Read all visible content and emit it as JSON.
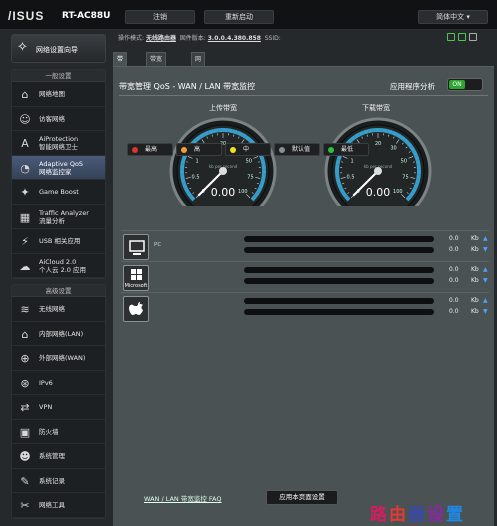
{
  "header": {
    "brand": "/ISUS",
    "model": "RT-AC88U",
    "logout": "注销",
    "reboot": "重新启动",
    "language": "简体中文",
    "opmode_label": "操作模式:",
    "opmode_value": "无线路由器",
    "firmware_label": "固件版本:",
    "firmware_value": "3.0.0.4.380.858",
    "ssid_label": "SSID:"
  },
  "sidebar": {
    "quick_setup": "网络设置向导",
    "general_header": "一般设置",
    "general_items": [
      {
        "icon": "network-map-icon",
        "label": "网络地图",
        "glyph": "⌂"
      },
      {
        "icon": "guest-network-icon",
        "label": "访客网络",
        "glyph": "☺"
      },
      {
        "icon": "aiprotection-icon",
        "label": "AiProtection",
        "sub": "智能网络卫士",
        "glyph": "A"
      },
      {
        "icon": "adaptive-qos-icon",
        "label": "Adaptive QoS",
        "sub": "网络监控家",
        "glyph": "◔"
      },
      {
        "icon": "game-boost-icon",
        "label": "Game Boost",
        "glyph": "✦"
      },
      {
        "icon": "traffic-analyzer-icon",
        "label": "Traffic Analyzer",
        "sub": "流量分析",
        "glyph": "▦"
      },
      {
        "icon": "usb-app-icon",
        "label": "USB 相关应用",
        "glyph": "⚡"
      },
      {
        "icon": "aicloud-icon",
        "label": "AiCloud 2.0",
        "sub": "个人云 2.0 应用",
        "glyph": "☁"
      }
    ],
    "advanced_header": "高级设置",
    "advanced_items": [
      {
        "icon": "wireless-icon",
        "label": "无线网络",
        "glyph": "≋"
      },
      {
        "icon": "lan-icon",
        "label": "内部网络(LAN)",
        "glyph": "⌂"
      },
      {
        "icon": "wan-icon",
        "label": "外部网络(WAN)",
        "glyph": "⊕"
      },
      {
        "icon": "ipv6-icon",
        "label": "IPv6",
        "glyph": "⊛"
      },
      {
        "icon": "vpn-icon",
        "label": "VPN",
        "glyph": "⇄"
      },
      {
        "icon": "firewall-icon",
        "label": "防火墙",
        "glyph": "▣"
      },
      {
        "icon": "administration-icon",
        "label": "系统管理",
        "glyph": "☻"
      },
      {
        "icon": "system-log-icon",
        "label": "系统记录",
        "glyph": "✎"
      },
      {
        "icon": "network-tools-icon",
        "label": "网络工具",
        "glyph": "✂"
      }
    ]
  },
  "tabs": [
    "带宽监控",
    "带宽管理 QoS",
    "网页浏览历史"
  ],
  "main": {
    "title": "带宽管理 QoS - WAN / LAN 带宽监控",
    "app_analysis_label": "应用程序分析",
    "toggle_state": "ON",
    "upload_label": "上传带宽",
    "download_label": "下载带宽",
    "gauge_unit": "kb per second",
    "gauge_ticks": [
      "0",
      "0.5",
      "1",
      "10",
      "20",
      "30",
      "50",
      "75",
      "100"
    ],
    "upload_value": "0.00",
    "download_value": "0.00",
    "faq_link": "WAN / LAN 带宽监控 FAQ",
    "apply_button": "应用本页面设置"
  },
  "legend": [
    {
      "label": "最高",
      "color": "#e03030"
    },
    {
      "label": "高",
      "color": "#f0a030"
    },
    {
      "label": "中",
      "color": "#f0e020"
    },
    {
      "label": "默认值",
      "color": "#8a8f90"
    },
    {
      "label": "最低",
      "color": "#30c040"
    }
  ],
  "clients": [
    {
      "icon": "pc-icon",
      "icon_text": "",
      "name": "PC",
      "up": "0.0",
      "down": "0.0",
      "unit": "Kb"
    },
    {
      "icon": "microsoft-icon",
      "icon_text": "Microsoft",
      "name": "",
      "up": "0.0",
      "down": "0.0",
      "unit": "Kb"
    },
    {
      "icon": "apple-icon",
      "icon_text": "",
      "name": "",
      "up": "0.0",
      "down": "0.0",
      "unit": "Kb"
    }
  ],
  "watermark": [
    "路",
    "由",
    "器",
    "设",
    "置"
  ],
  "colors": {
    "accent_green": "#2ea52e",
    "active_item": "#4a5a78",
    "panel": "#4b5253"
  }
}
